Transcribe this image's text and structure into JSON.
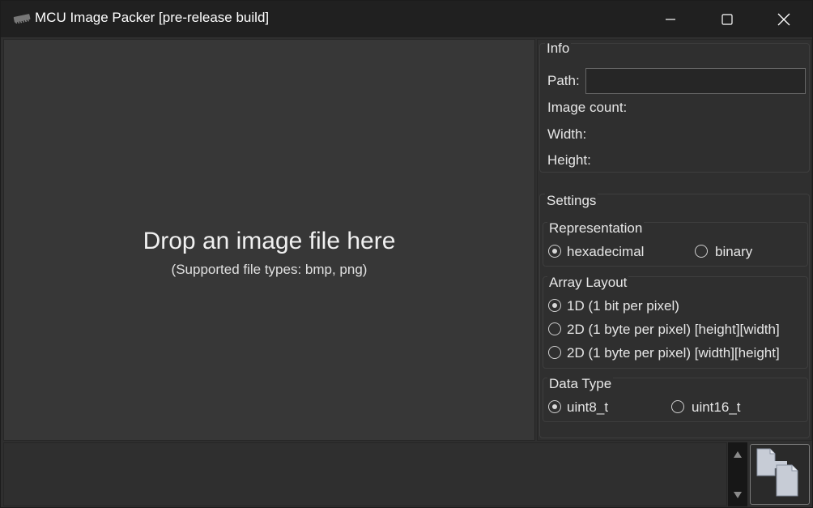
{
  "window": {
    "title": "MCU Image Packer [pre-release build]"
  },
  "drop": {
    "title": "Drop an image file here",
    "subtitle": "(Supported file types: bmp, png)"
  },
  "info": {
    "title": "Info",
    "path_label": "Path:",
    "path_value": "",
    "image_count_label": "Image count:",
    "width_label": "Width:",
    "height_label": "Height:"
  },
  "settings": {
    "title": "Settings",
    "representation": {
      "title": "Representation",
      "options": [
        "hexadecimal",
        "binary"
      ],
      "selected": "hexadecimal"
    },
    "array_layout": {
      "title": "Array Layout",
      "options": [
        "1D (1 bit per pixel)",
        "2D (1 byte per pixel) [height][width]",
        "2D (1 byte per pixel) [width][height]"
      ],
      "selected": "1D (1 bit per pixel)"
    },
    "data_type": {
      "title": "Data Type",
      "options": [
        "uint8_t",
        "uint16_t"
      ],
      "selected": "uint8_t"
    }
  },
  "icons": {
    "app": "chip-icon",
    "minimize": "minimize-icon",
    "maximize": "maximize-icon",
    "close": "close-icon",
    "copy": "copy-icon",
    "scroll_up": "triangle-up-icon",
    "scroll_down": "triangle-down-icon"
  },
  "colors": {
    "titlebar": "#202020",
    "window_bg": "#2f2f2f",
    "drop_bg": "#373737",
    "text": "#e6e6e6"
  }
}
